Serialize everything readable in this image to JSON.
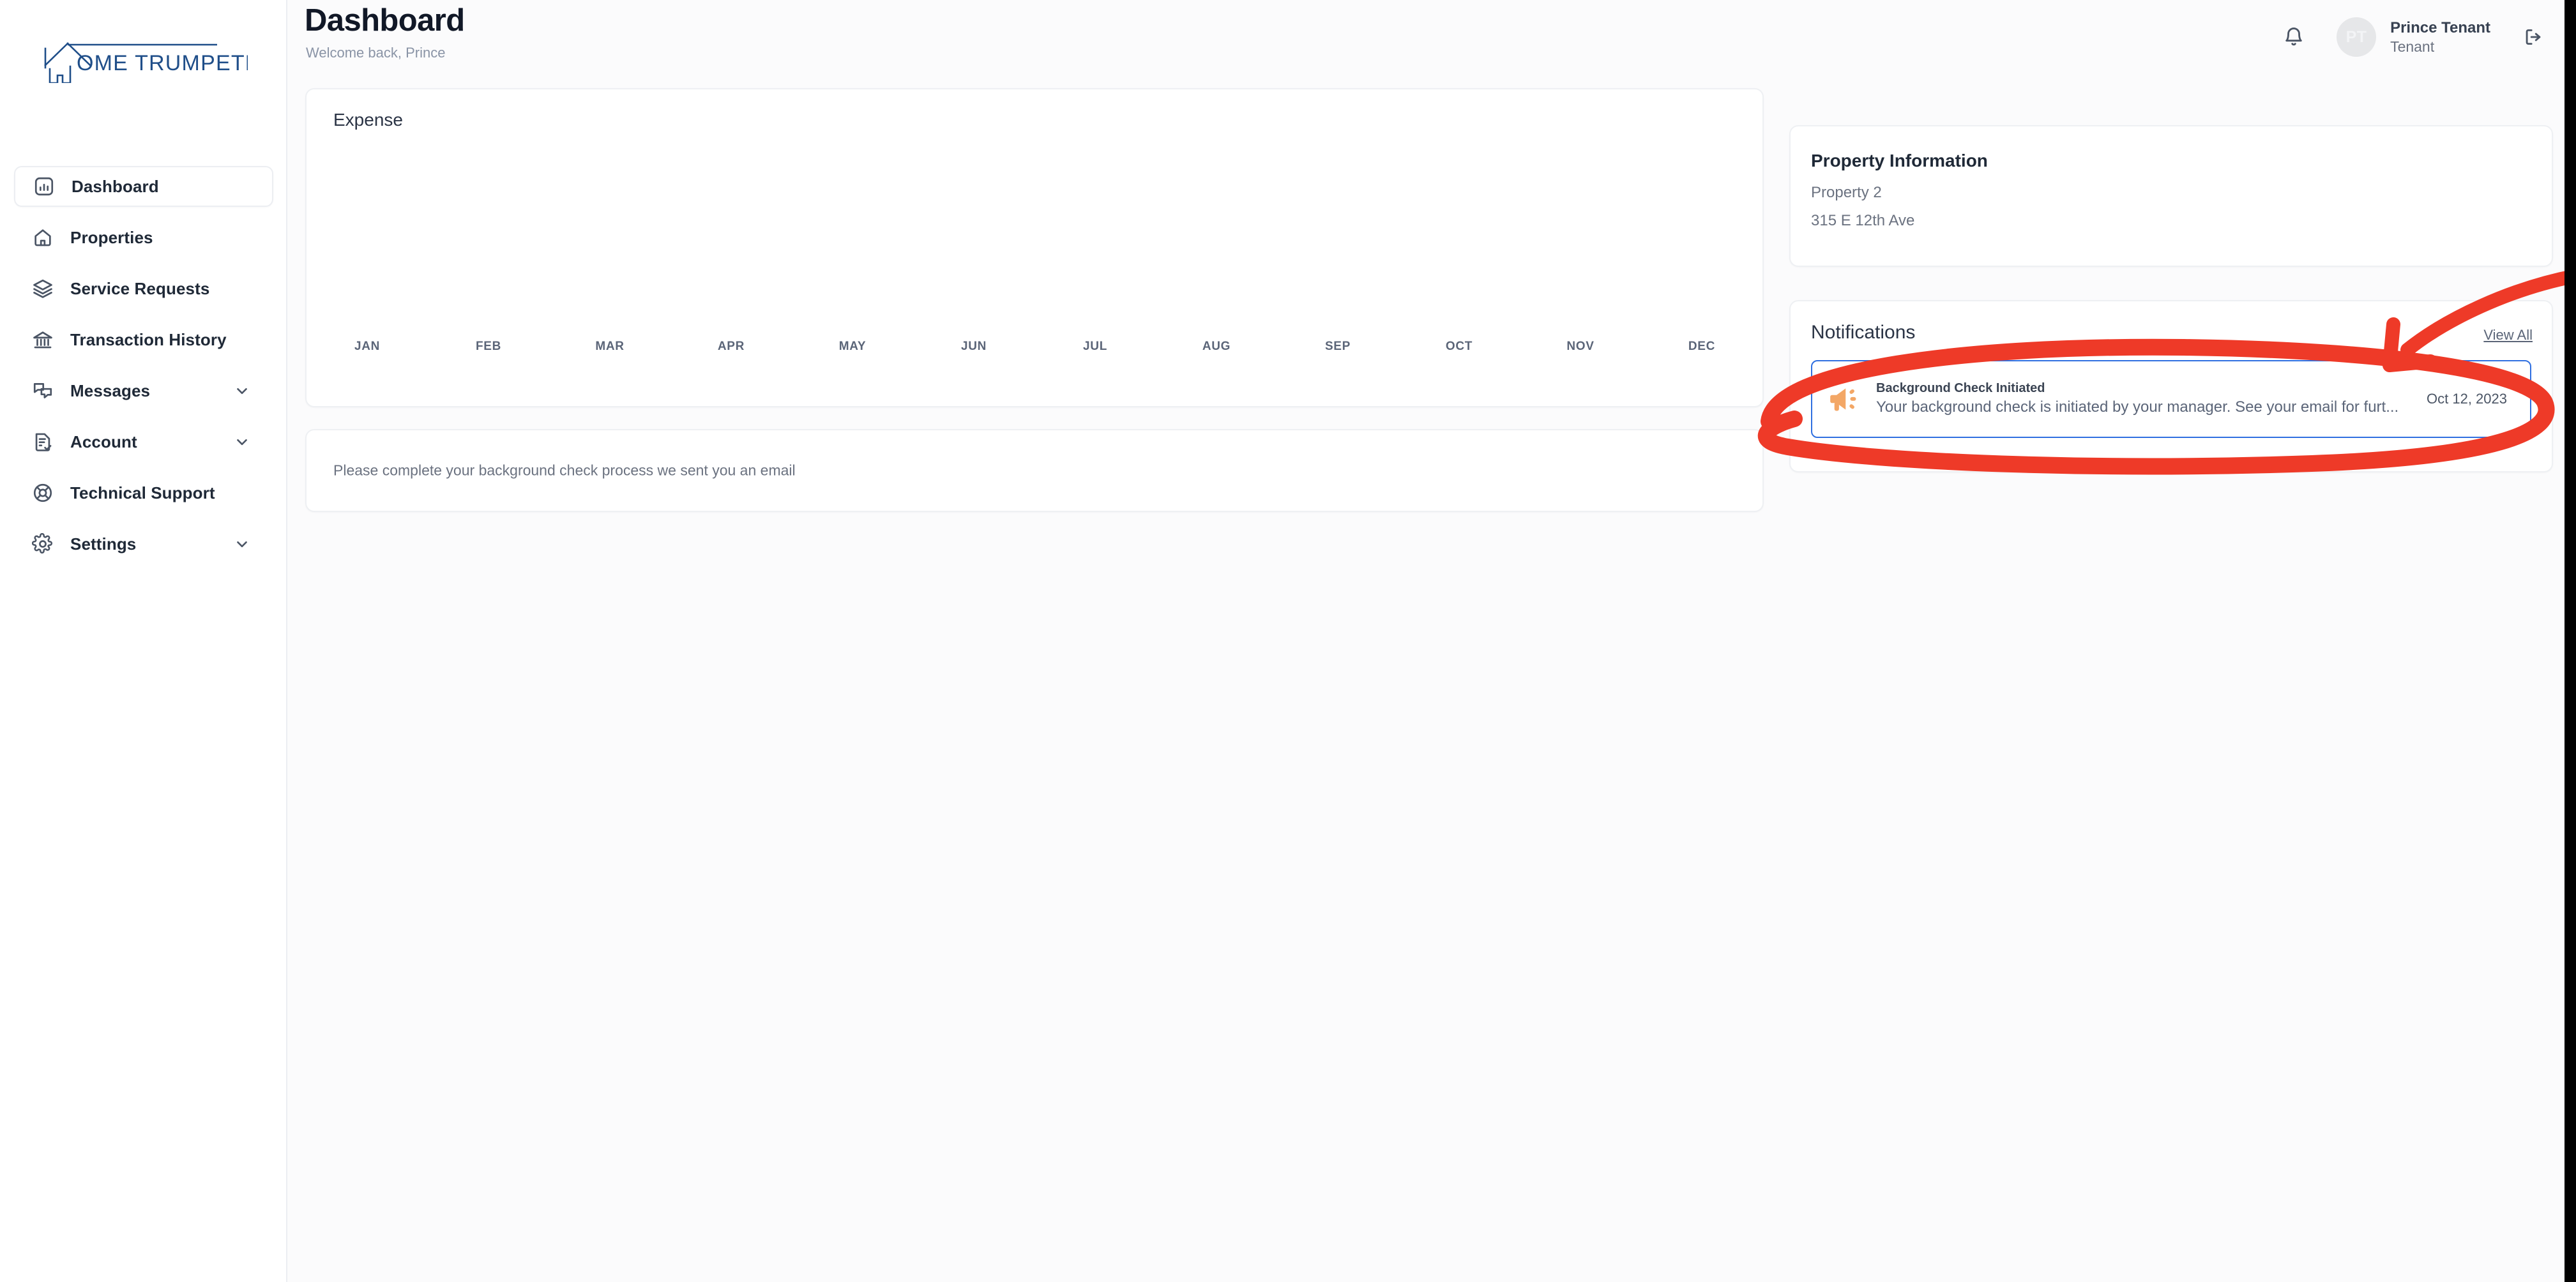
{
  "brand": {
    "logo_text": "OME TRUMPETER",
    "logo_full_name": "HOME TRUMPETER",
    "logo_color": "#1f4e89"
  },
  "sidebar": {
    "items": [
      {
        "label": "Dashboard",
        "icon": "bar-chart-icon",
        "active": true,
        "expandable": false
      },
      {
        "label": "Properties",
        "icon": "home-icon",
        "active": false,
        "expandable": false
      },
      {
        "label": "Service Requests",
        "icon": "layers-icon",
        "active": false,
        "expandable": false
      },
      {
        "label": "Transaction History",
        "icon": "bank-icon",
        "active": false,
        "expandable": false
      },
      {
        "label": "Messages",
        "icon": "chat-bubbles-icon",
        "active": false,
        "expandable": true
      },
      {
        "label": "Account",
        "icon": "document-check-icon",
        "active": false,
        "expandable": true
      },
      {
        "label": "Technical Support",
        "icon": "lifebuoy-icon",
        "active": false,
        "expandable": false
      },
      {
        "label": "Settings",
        "icon": "gear-icon",
        "active": false,
        "expandable": true
      }
    ]
  },
  "header": {
    "title": "Dashboard",
    "subtitle": "Welcome back, Prince",
    "bell_icon": "bell-icon",
    "logout_icon": "logout-icon",
    "user": {
      "initials": "PT",
      "name": "Prince Tenant",
      "role": "Tenant"
    }
  },
  "expense_card": {
    "title": "Expense"
  },
  "notice_card": {
    "text": "Please complete your background check process we sent you an email"
  },
  "property_card": {
    "title": "Property Information",
    "property_name": "Property 2",
    "address": "315 E 12th Ave"
  },
  "notifications_card": {
    "title": "Notifications",
    "view_all_label": "View All",
    "items": [
      {
        "icon": "megaphone-icon",
        "icon_color": "#f3a766",
        "title": "Background Check Initiated",
        "description": "Your background check is initiated by your manager. See your email for furt...",
        "date": "Oct 12, 2023",
        "highlighted": true
      }
    ]
  },
  "chart_data": {
    "type": "bar",
    "title": "Expense",
    "categories": [
      "JAN",
      "FEB",
      "MAR",
      "APR",
      "MAY",
      "JUN",
      "JUL",
      "AUG",
      "SEP",
      "OCT",
      "NOV",
      "DEC"
    ],
    "values": [
      0,
      0,
      0,
      0,
      0,
      0,
      0,
      0,
      0,
      0,
      0,
      0
    ],
    "xlabel": "",
    "ylabel": "",
    "grid": false,
    "legend": "none",
    "note": "No data plotted — chart body is empty, only month tick labels are rendered"
  },
  "annotation": {
    "color": "#ee3a28",
    "shapes": [
      "ellipse-around-notification-item",
      "arrow-pointing-to-notification-item"
    ]
  },
  "colors": {
    "accent_blue": "#2f6fe0",
    "brand_navy": "#1f4e89",
    "annotation_red": "#ee3a28",
    "page_bg": "#fbfbfc"
  }
}
